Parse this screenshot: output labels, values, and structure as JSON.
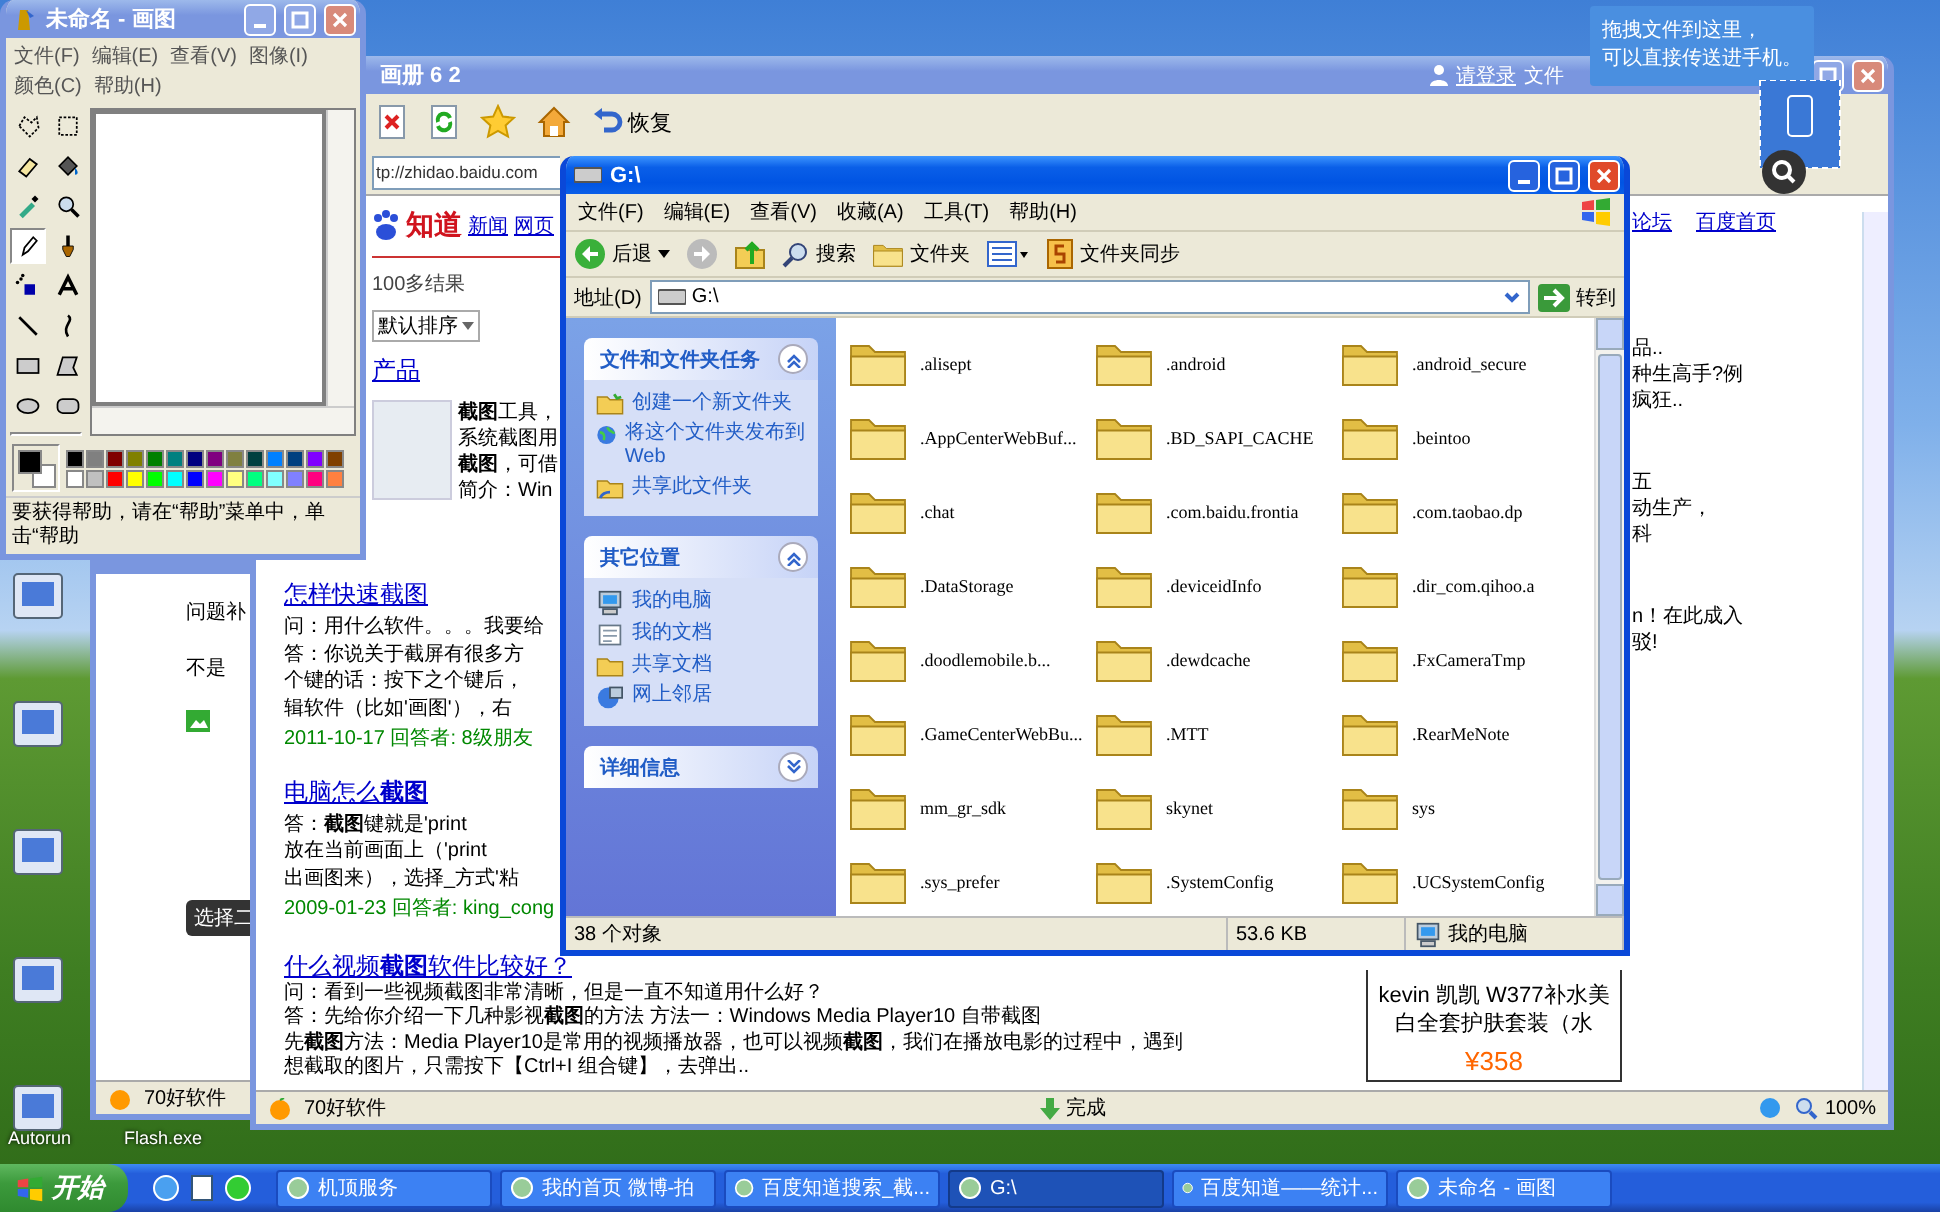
{
  "desktop": {
    "icons": [
      {
        "label": "Autorun"
      },
      {
        "label": "Flash.exe"
      }
    ]
  },
  "back_window": {
    "lines": [
      "问题补",
      "不是"
    ],
    "tip": "选择二",
    "status": "70好软件"
  },
  "browser": {
    "title": "画册 6 2",
    "login": "请登录",
    "menu": "文件",
    "restore": "恢复",
    "address": "tp://zhidao.baidu.com",
    "logo": "知道",
    "nav": [
      "新闻",
      "网页"
    ],
    "right_links": [
      "论坛",
      "百度首页"
    ],
    "result_count": "100多结果",
    "sort": "默认排序",
    "product_heading": "产品",
    "product_lines": [
      "**截图**工具，",
      "系统截图用",
      "**截图**，可借",
      "简介：Win"
    ],
    "results": [
      {
        "title": "怎样快速截图",
        "lines": [
          "问：用什么软件。。。我要给",
          "答：你说关于截屏有很多方",
          "个键的话：按下之个键后，",
          "辑软件（比如'画图'），右"
        ],
        "meta": "2011-10-17 回答者: 8级朋友"
      },
      {
        "title": "电脑怎么**截图**",
        "lines": [
          "答：**截图**键就是'print",
          "放在当前画面上（'print",
          "出画图来），选择_方式'粘"
        ],
        "meta": "2009-01-23 回答者: king_cong"
      },
      {
        "title": "什么视频**截图**软件比较好？",
        "lines": [
          "问：看到一些视频截图非常清晰，但是一直不知道用什么好？",
          "答：先给你介绍一下几种影视**截图**的方法 方法一：Windows Media Player10 自带截图",
          "先**截图**方法：Media Player10是常用的视频播放器，也可以视频**截图**，我们在播放电影的过程中，遇到",
          "想截取的图片，只需按下【Ctrl+I 组合键】，去弹出.."
        ]
      }
    ],
    "right_fragments": [
      {
        "lines": [
          "品..",
          "种生高手?例",
          "疯狂.."
        ]
      },
      {
        "lines": [
          "五",
          "动生产，",
          "科"
        ]
      },
      {
        "lines": [
          "n！在此成入",
          "驳!"
        ]
      }
    ],
    "ad": {
      "title": "kevin 凯凯 W377补水美白全套护肤套装（水",
      "price": "¥358"
    },
    "status": {
      "left": "70好软件",
      "right": "完成",
      "zoom": "100%"
    }
  },
  "explorer": {
    "title": "G:\\",
    "menus": [
      "文件(F)",
      "编辑(E)",
      "查看(V)",
      "收藏(A)",
      "工具(T)",
      "帮助(H)"
    ],
    "back": "后退",
    "search": "搜索",
    "folders": "文件夹",
    "sync": "文件夹同步",
    "address_label": "地址(D)",
    "address": "G:\\",
    "go": "转到",
    "panels": [
      {
        "title": "文件和文件夹任务",
        "expanded": true,
        "items": [
          "创建一个新文件夹",
          "将这个文件夹发布到 Web",
          "共享此文件夹"
        ]
      },
      {
        "title": "其它位置",
        "expanded": true,
        "items": [
          "我的电脑",
          "我的文档",
          "共享文档",
          "网上邻居"
        ]
      },
      {
        "title": "详细信息",
        "expanded": false
      }
    ],
    "files": [
      ".alisept",
      ".android",
      ".android_secure",
      ".AppCenterWebBuf...",
      ".BD_SAPI_CACHE",
      ".beintoo",
      ".chat",
      ".com.baidu.frontia",
      ".com.taobao.dp",
      ".DataStorage",
      ".deviceidInfo",
      ".dir_com.qihoo.a",
      ".doodlemobile.b...",
      ".dewdcache",
      ".FxCameraTmp",
      ".GameCenterWebBu...",
      ".MTT",
      ".RearMeNote",
      "mm_gr_sdk",
      "skynet",
      "sys",
      ".sys_prefer",
      ".SystemConfig",
      ".UCSystemConfig"
    ],
    "status": {
      "objects": "38 个对象",
      "size": "53.6 KB",
      "location": "我的电脑"
    }
  },
  "paint": {
    "title": "未命名 - 画图",
    "menus": [
      "文件(F)",
      "编辑(E)",
      "查看(V)",
      "图像(I)",
      "颜色(C)",
      "帮助(H)"
    ],
    "tools": [
      {
        "kind": "free-select",
        "selected": false
      },
      {
        "kind": "select",
        "selected": false
      },
      {
        "kind": "eraser",
        "selected": false
      },
      {
        "kind": "fill",
        "selected": false
      },
      {
        "kind": "picker",
        "selected": false
      },
      {
        "kind": "magnifier",
        "selected": false
      },
      {
        "kind": "pencil",
        "selected": true
      },
      {
        "kind": "brush",
        "selected": false
      },
      {
        "kind": "airbrush",
        "selected": false
      },
      {
        "kind": "text",
        "selected": false
      },
      {
        "kind": "line",
        "selected": false
      },
      {
        "kind": "curve",
        "selected": false
      },
      {
        "kind": "rectangle",
        "selected": false
      },
      {
        "kind": "polygon",
        "selected": false
      },
      {
        "kind": "ellipse",
        "selected": false
      },
      {
        "kind": "rounded-rectangle",
        "selected": false
      }
    ],
    "palette": [
      {
        "color": "#000000"
      },
      {
        "color": "#808080"
      },
      {
        "color": "#800000"
      },
      {
        "color": "#808000"
      },
      {
        "color": "#008000"
      },
      {
        "color": "#008080"
      },
      {
        "color": "#000080"
      },
      {
        "color": "#800080"
      },
      {
        "color": "#808040"
      },
      {
        "color": "#004040"
      },
      {
        "color": "#0080ff"
      },
      {
        "color": "#004080"
      },
      {
        "color": "#8000ff"
      },
      {
        "color": "#804000"
      },
      {
        "color": "#ffffff"
      },
      {
        "color": "#c0c0c0"
      },
      {
        "color": "#ff0000"
      },
      {
        "color": "#ffff00"
      },
      {
        "color": "#00ff00"
      },
      {
        "color": "#00ffff"
      },
      {
        "color": "#0000ff"
      },
      {
        "color": "#ff00ff"
      },
      {
        "color": "#ffff80"
      },
      {
        "color": "#00ff80"
      },
      {
        "color": "#80ffff"
      },
      {
        "color": "#8080ff"
      },
      {
        "color": "#ff0080"
      },
      {
        "color": "#ff8040"
      }
    ],
    "status": "要获得帮助，请在“帮助”菜单中，单击“帮助"
  },
  "tooltip": {
    "lines": [
      "拖拽文件到这里，",
      "可以直接传送进手机。"
    ]
  },
  "taskbar": {
    "start": "开始",
    "tasks": [
      {
        "label": "机顶服务",
        "selected": false
      },
      {
        "label": "我的首页 微博-拍",
        "selected": false
      },
      {
        "label": "百度知道搜索_截...",
        "selected": false
      },
      {
        "label": "G:\\",
        "selected": true
      },
      {
        "label": "百度知道——统计...",
        "selected": false
      },
      {
        "label": "未命名 - 画图",
        "selected": false
      }
    ]
  }
}
